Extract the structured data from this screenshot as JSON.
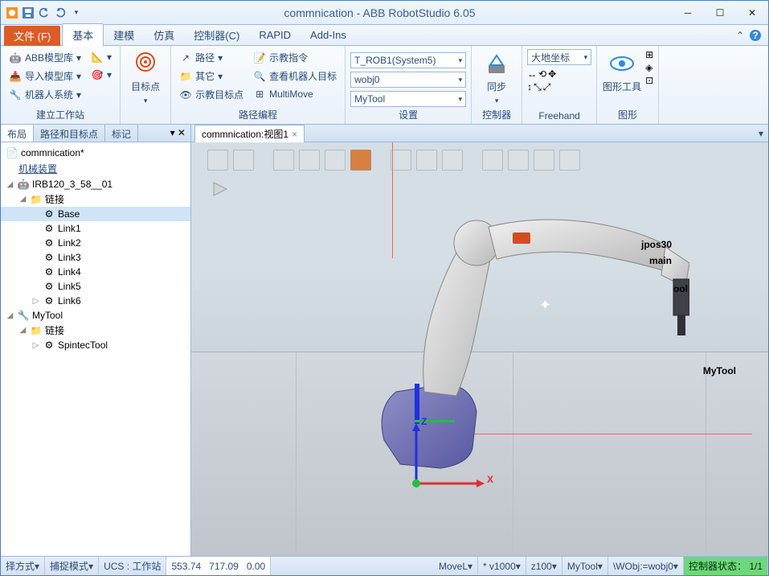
{
  "title": "commnication - ABB RobotStudio 6.05",
  "menu": {
    "file": "文件 (F)",
    "basic": "基本",
    "model": "建模",
    "sim": "仿真",
    "ctrl": "控制器(C)",
    "rapid": "RAPID",
    "addins": "Add-Ins"
  },
  "ribbon": {
    "g1": {
      "label": "建立工作站",
      "abb": "ABB模型库",
      "import": "导入模型库",
      "sys": "机器人系统"
    },
    "g2": {
      "label": "",
      "target": "目标点"
    },
    "g3": {
      "label": "路径编程",
      "path": "路径",
      "other": "其它",
      "show": "示教目标点",
      "teach": "示教指令",
      "find": "查看机器人目标",
      "mm": "MultiMove"
    },
    "g4": {
      "label": "设置",
      "task": "T_ROB1(System5)",
      "wobj": "wobj0",
      "tool": "MyTool"
    },
    "g5": {
      "label": "控制器",
      "sync": "同步"
    },
    "g6": {
      "label": "Freehand",
      "coord": "大地坐标"
    },
    "g7": {
      "label": "图形",
      "tool": "图形工具"
    }
  },
  "side": {
    "tab1": "布局",
    "tab2": "路径和目标点",
    "tab3": "标记",
    "root": "commnication*",
    "section": "机械装置",
    "robot": "IRB120_3_58__01",
    "links": "链接",
    "l0": "Base",
    "l1": "Link1",
    "l2": "Link2",
    "l3": "Link3",
    "l4": "Link4",
    "l5": "Link5",
    "l6": "Link6",
    "mytool": "MyTool",
    "links2": "链接",
    "spin": "SpintecTool"
  },
  "view": {
    "tab": "commnication:视图1"
  },
  "scene": {
    "jpos": "jpos30",
    "main": "main",
    "tool": "ool",
    "mytool": "MyTool",
    "z": "Z",
    "x": "X"
  },
  "status": {
    "mode1": "择方式",
    "mode2": "捕捉模式",
    "ucs": "UCS : 工作站",
    "x": "553.74",
    "y": "717.09",
    "z": "0.00",
    "movel": "MoveL",
    "v": "* v1000",
    "zone": "z100",
    "tool": "MyTool",
    "wobj": "\\WObj:=wobj0",
    "ctrl": "控制器状态：",
    "ratio": "1/1"
  }
}
